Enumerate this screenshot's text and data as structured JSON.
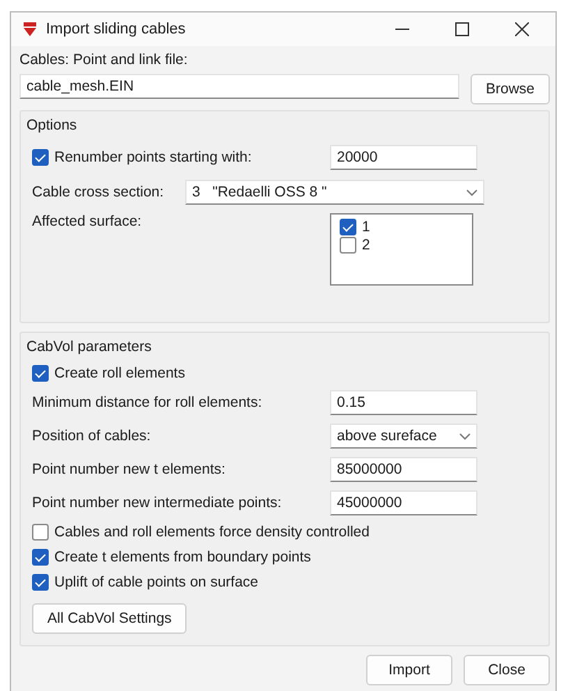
{
  "window": {
    "title": "Import sliding cables"
  },
  "file": {
    "label": "Cables: Point and link file:",
    "value": "cable_mesh.EIN",
    "button": "Browse"
  },
  "options": {
    "title": "Options",
    "renumber": {
      "label": "Renumber points starting with:",
      "checked": true,
      "value": "20000"
    },
    "cross_section": {
      "label": "Cable cross section:",
      "value": "3   \"Redaelli OSS 8 \""
    },
    "surface": {
      "label": "Affected surface:",
      "items": [
        {
          "label": "1",
          "checked": true
        },
        {
          "label": "2",
          "checked": false
        }
      ]
    }
  },
  "cabvol": {
    "title": "CabVol parameters",
    "rows": [
      {
        "kind": "check",
        "label": "Create roll elements",
        "checked": true
      },
      {
        "kind": "input",
        "label": "Minimum distance for roll elements:",
        "value": "0.15"
      },
      {
        "kind": "select",
        "label": "Position of cables:",
        "value": "above sureface"
      },
      {
        "kind": "input",
        "label": "Point number new t elements:",
        "value": "85000000"
      },
      {
        "kind": "input",
        "label": "Point number new intermediate points:",
        "value": "45000000"
      },
      {
        "kind": "check",
        "label": "Cables and roll elements force density controlled",
        "checked": false
      },
      {
        "kind": "check",
        "label": "Create t elements from boundary points",
        "checked": true
      },
      {
        "kind": "check",
        "label": "Uplift of cable points on surface",
        "checked": true
      }
    ],
    "button": "All CabVol Settings"
  },
  "buttons": [
    "Import",
    "Close"
  ]
}
